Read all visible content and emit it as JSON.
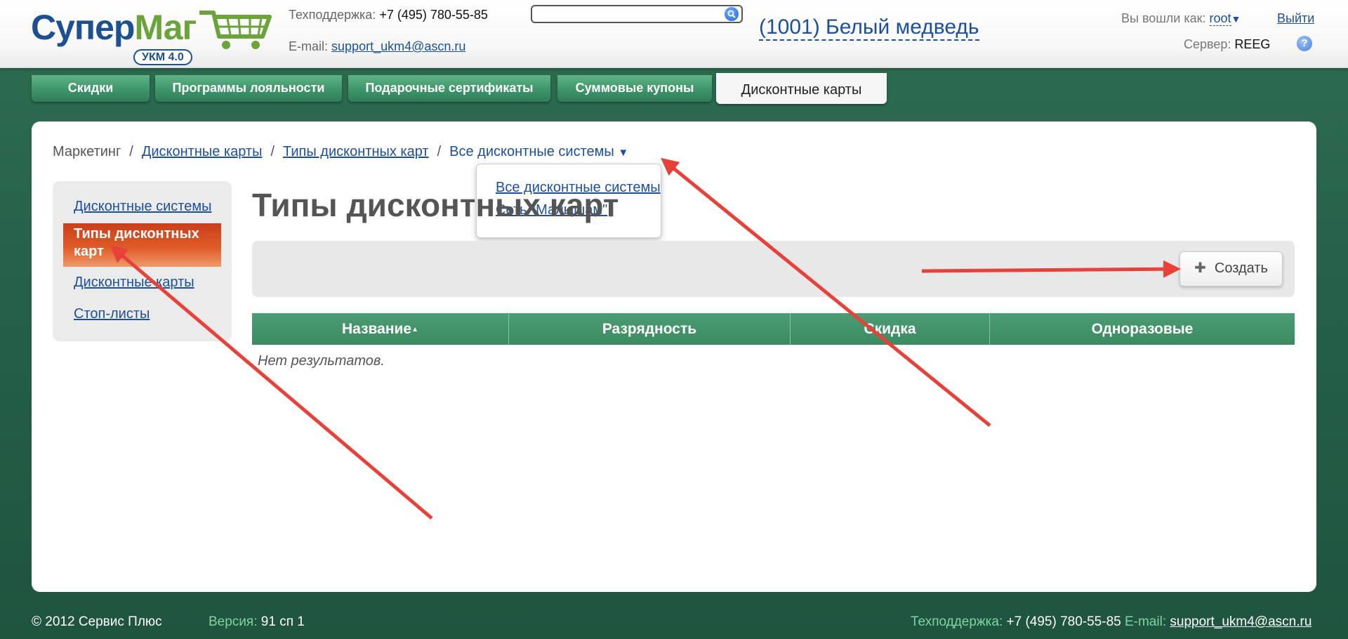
{
  "header": {
    "logo_main": "Супер",
    "logo_accent": "Маг",
    "logo_badge": "УКМ 4.0",
    "support_label": "Техподдержка:",
    "support_phone": "+7 (495) 780-55-85",
    "email_label": "E-mail:",
    "email": "support_ukm4@ascn.ru",
    "search_value": "",
    "store_title": "(1001) Белый медведь",
    "logged_in_label": "Вы вошли как:",
    "user": "root",
    "logout": "Выйти",
    "server_label": "Сервер:",
    "server": "REEG",
    "help_glyph": "?"
  },
  "tabs": [
    {
      "label": "Скидки",
      "active": false
    },
    {
      "label": "Программы лояльности",
      "active": false
    },
    {
      "label": "Подарочные сертификаты",
      "active": false
    },
    {
      "label": "Суммовые купоны",
      "active": false
    },
    {
      "label": "Дисконтные карты",
      "active": true
    }
  ],
  "breadcrumb": {
    "root": "Маркетинг",
    "level1": "Дисконтные карты",
    "level2": "Типы дисконтных карт",
    "current": "Все дисконтные системы",
    "separator": "/",
    "caret": "▼"
  },
  "dropdown": {
    "options": [
      "Все дисконтные системы",
      "Сеть \"Малышам\""
    ]
  },
  "sidebar": {
    "items": [
      {
        "label": "Дисконтные системы",
        "active": false
      },
      {
        "label": "Типы дисконтных карт",
        "active": true
      },
      {
        "label": "Дисконтные карты",
        "active": false
      },
      {
        "label": "Стоп-листы",
        "active": false
      }
    ]
  },
  "main": {
    "title": "Типы дисконтных карт",
    "create_button": "Создать",
    "table_headers": [
      "Название",
      "Разрядность",
      "Скидка",
      "Одноразовые"
    ],
    "sort_indicator": "▲",
    "no_results": "Нет результатов."
  },
  "footer": {
    "copyright": "© 2012 Сервис Плюс",
    "version_label": "Версия:",
    "version": "91 сп 1",
    "support_label": "Техподдержка:",
    "support_phone": "+7 (495) 780-55-85",
    "email_label": "E-mail:",
    "email": "support_ukm4@ascn.ru"
  },
  "colors": {
    "annotation_arrow": "#e8413a",
    "tab_green": "#3e956a",
    "sidebar_active": "#df5a26",
    "link_blue": "#1c4f9c"
  }
}
